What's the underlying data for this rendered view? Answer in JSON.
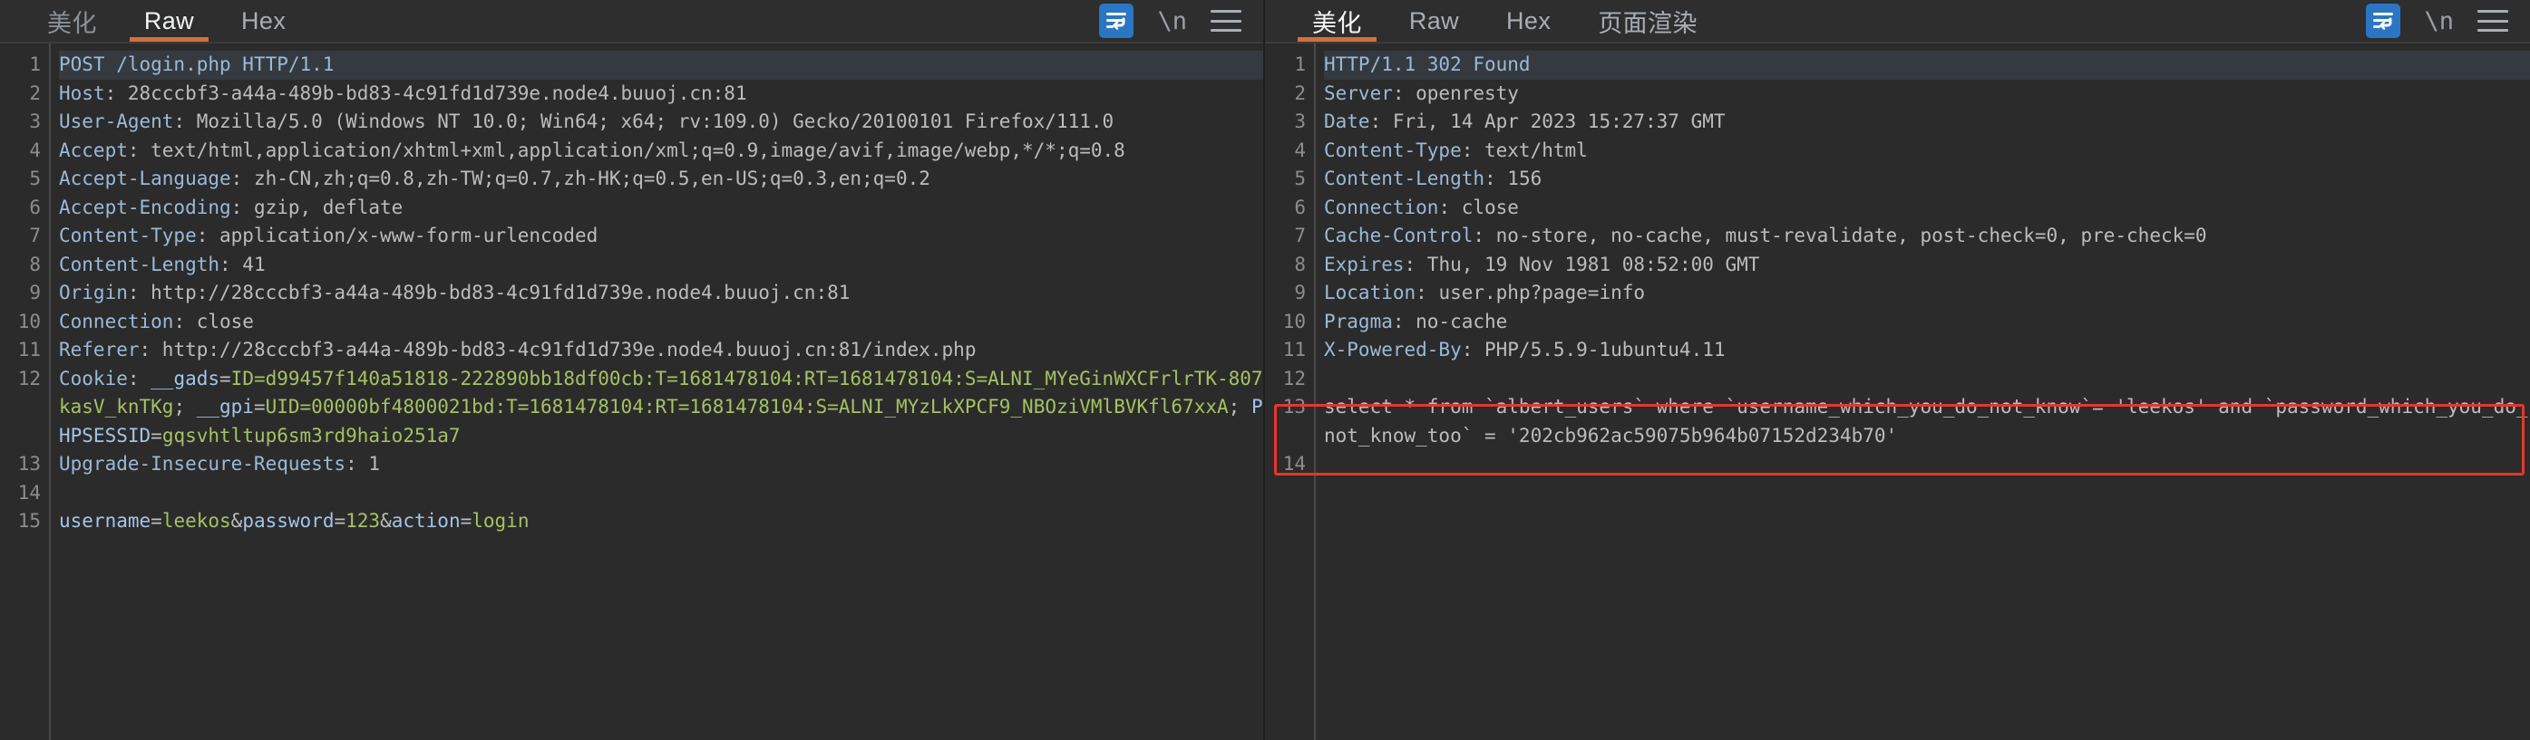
{
  "request_panel": {
    "tabs": [
      {
        "label": "美化",
        "name": "beautify",
        "active": false,
        "dim": true
      },
      {
        "label": "Raw",
        "name": "raw",
        "active": true,
        "dim": false
      },
      {
        "label": "Hex",
        "name": "hex",
        "active": false,
        "dim": false
      }
    ],
    "toolbar": {
      "wrap_icon": "word-wrap-icon",
      "newline_label": "\\n",
      "menu_icon": "hamburger-menu-icon"
    },
    "lines": [
      {
        "no": "1",
        "highlight": true,
        "parts": [
          {
            "t": "POST /login.php HTTP/1.1",
            "c": "k"
          }
        ]
      },
      {
        "no": "2",
        "highlight": false,
        "parts": [
          {
            "t": "Host",
            "c": "k"
          },
          {
            "t": ": 28cccbf3-a44a-489b-bd83-4c91fd1d739e.node4.buuoj.cn:81",
            "c": "v"
          }
        ]
      },
      {
        "no": "3",
        "highlight": false,
        "parts": [
          {
            "t": "User-Agent",
            "c": "k"
          },
          {
            "t": ": Mozilla/5.0 (Windows NT 10.0; Win64; x64; rv:109.0) Gecko/20100101 Firefox/111.0",
            "c": "v"
          }
        ]
      },
      {
        "no": "4",
        "highlight": false,
        "parts": [
          {
            "t": "Accept",
            "c": "k"
          },
          {
            "t": ": text/html,application/xhtml+xml,application/xml;q=0.9,image/avif,image/webp,*/*;q=0.8",
            "c": "v"
          }
        ]
      },
      {
        "no": "5",
        "highlight": false,
        "parts": [
          {
            "t": "Accept-Language",
            "c": "k"
          },
          {
            "t": ": zh-CN,zh;q=0.8,zh-TW;q=0.7,zh-HK;q=0.5,en-US;q=0.3,en;q=0.2",
            "c": "v"
          }
        ]
      },
      {
        "no": "6",
        "highlight": false,
        "parts": [
          {
            "t": "Accept-Encoding",
            "c": "k"
          },
          {
            "t": ": gzip, deflate",
            "c": "v"
          }
        ]
      },
      {
        "no": "7",
        "highlight": false,
        "parts": [
          {
            "t": "Content-Type",
            "c": "k"
          },
          {
            "t": ": application/x-www-form-urlencoded",
            "c": "v"
          }
        ]
      },
      {
        "no": "8",
        "highlight": false,
        "parts": [
          {
            "t": "Content-Length",
            "c": "k"
          },
          {
            "t": ": 41",
            "c": "v"
          }
        ]
      },
      {
        "no": "9",
        "highlight": false,
        "parts": [
          {
            "t": "Origin",
            "c": "k"
          },
          {
            "t": ": http://28cccbf3-a44a-489b-bd83-4c91fd1d739e.node4.buuoj.cn:81",
            "c": "v"
          }
        ]
      },
      {
        "no": "10",
        "highlight": false,
        "parts": [
          {
            "t": "Connection",
            "c": "k"
          },
          {
            "t": ": close",
            "c": "v"
          }
        ]
      },
      {
        "no": "11",
        "highlight": false,
        "parts": [
          {
            "t": "Referer",
            "c": "k"
          },
          {
            "t": ": http://28cccbf3-a44a-489b-bd83-4c91fd1d739e.node4.buuoj.cn:81/index.php",
            "c": "v"
          }
        ]
      },
      {
        "no": "12",
        "highlight": false,
        "parts": [
          {
            "t": "Cookie",
            "c": "k"
          },
          {
            "t": ": ",
            "c": "v"
          },
          {
            "t": "__gads",
            "c": "kb"
          },
          {
            "t": "=",
            "c": "v"
          },
          {
            "t": "ID=d99457f140a51818-222890bb18df00cb:T=1681478104:RT=1681478104:S=ALNI_MYeGinWXCFrlrTK-807kasV_knTKg",
            "c": "g"
          },
          {
            "t": "; ",
            "c": "v"
          },
          {
            "t": "__gpi",
            "c": "kb"
          },
          {
            "t": "=",
            "c": "v"
          },
          {
            "t": "UID=00000bf4800021bd:T=1681478104:RT=1681478104:S=ALNI_MYzLkXPCF9_NBOziVMlBVKfl67xxA",
            "c": "g"
          },
          {
            "t": "; ",
            "c": "v"
          },
          {
            "t": "PHPSESSID",
            "c": "kb"
          },
          {
            "t": "=",
            "c": "v"
          },
          {
            "t": "gqsvhtltup6sm3rd9haio251a7",
            "c": "g"
          }
        ]
      },
      {
        "no": "13",
        "highlight": false,
        "parts": [
          {
            "t": "Upgrade-Insecure-Requests",
            "c": "k"
          },
          {
            "t": ": 1",
            "c": "v"
          }
        ]
      },
      {
        "no": "14",
        "highlight": false,
        "parts": [
          {
            "t": "",
            "c": "v"
          }
        ]
      },
      {
        "no": "15",
        "highlight": false,
        "parts": [
          {
            "t": "username",
            "c": "kb"
          },
          {
            "t": "=",
            "c": "v"
          },
          {
            "t": "leekos",
            "c": "g"
          },
          {
            "t": "&",
            "c": "v"
          },
          {
            "t": "password",
            "c": "kb"
          },
          {
            "t": "=",
            "c": "v"
          },
          {
            "t": "123",
            "c": "g"
          },
          {
            "t": "&",
            "c": "v"
          },
          {
            "t": "action",
            "c": "kb"
          },
          {
            "t": "=",
            "c": "v"
          },
          {
            "t": "login",
            "c": "g"
          }
        ]
      }
    ]
  },
  "response_panel": {
    "tabs": [
      {
        "label": "美化",
        "name": "beautify",
        "active": true,
        "dim": false
      },
      {
        "label": "Raw",
        "name": "raw",
        "active": false,
        "dim": false
      },
      {
        "label": "Hex",
        "name": "hex",
        "active": false,
        "dim": false
      },
      {
        "label": "页面渲染",
        "name": "page-render",
        "active": false,
        "dim": false
      }
    ],
    "toolbar": {
      "wrap_icon": "word-wrap-icon",
      "newline_label": "\\n",
      "menu_icon": "hamburger-menu-icon"
    },
    "highlight_box_color": "#e8352e",
    "lines": [
      {
        "no": "1",
        "highlight": true,
        "parts": [
          {
            "t": "HTTP/1.1 302 Found",
            "c": "k"
          }
        ]
      },
      {
        "no": "2",
        "highlight": false,
        "parts": [
          {
            "t": "Server",
            "c": "k"
          },
          {
            "t": ": openresty",
            "c": "v"
          }
        ]
      },
      {
        "no": "3",
        "highlight": false,
        "parts": [
          {
            "t": "Date",
            "c": "k"
          },
          {
            "t": ": Fri, 14 Apr 2023 15:27:37 GMT",
            "c": "v"
          }
        ]
      },
      {
        "no": "4",
        "highlight": false,
        "parts": [
          {
            "t": "Content-Type",
            "c": "k"
          },
          {
            "t": ": text/html",
            "c": "v"
          }
        ]
      },
      {
        "no": "5",
        "highlight": false,
        "parts": [
          {
            "t": "Content-Length",
            "c": "k"
          },
          {
            "t": ": 156",
            "c": "v"
          }
        ]
      },
      {
        "no": "6",
        "highlight": false,
        "parts": [
          {
            "t": "Connection",
            "c": "k"
          },
          {
            "t": ": close",
            "c": "v"
          }
        ]
      },
      {
        "no": "7",
        "highlight": false,
        "parts": [
          {
            "t": "Cache-Control",
            "c": "k"
          },
          {
            "t": ": no-store, no-cache, must-revalidate, post-check=0, pre-check=0",
            "c": "v"
          }
        ]
      },
      {
        "no": "8",
        "highlight": false,
        "parts": [
          {
            "t": "Expires",
            "c": "k"
          },
          {
            "t": ": Thu, 19 Nov 1981 08:52:00 GMT",
            "c": "v"
          }
        ]
      },
      {
        "no": "9",
        "highlight": false,
        "parts": [
          {
            "t": "Location",
            "c": "k"
          },
          {
            "t": ": user.php?page=info",
            "c": "v"
          }
        ]
      },
      {
        "no": "10",
        "highlight": false,
        "parts": [
          {
            "t": "Pragma",
            "c": "k"
          },
          {
            "t": ": no-cache",
            "c": "v"
          }
        ]
      },
      {
        "no": "11",
        "highlight": false,
        "parts": [
          {
            "t": "X-Powered-By",
            "c": "k"
          },
          {
            "t": ": PHP/5.5.9-1ubuntu4.11",
            "c": "v"
          }
        ]
      },
      {
        "no": "12",
        "highlight": false,
        "parts": [
          {
            "t": "",
            "c": "v"
          }
        ]
      },
      {
        "no": "13",
        "highlight": false,
        "parts": [
          {
            "t": "select * from `albert_users` where `username_which_you_do_not_know`= 'leekos' and `password_which_you_do_not_know_too` = '202cb962ac59075b964b07152d234b70'",
            "c": "v"
          }
        ]
      },
      {
        "no": "14",
        "highlight": false,
        "parts": [
          {
            "t": "",
            "c": "v"
          }
        ]
      }
    ]
  }
}
